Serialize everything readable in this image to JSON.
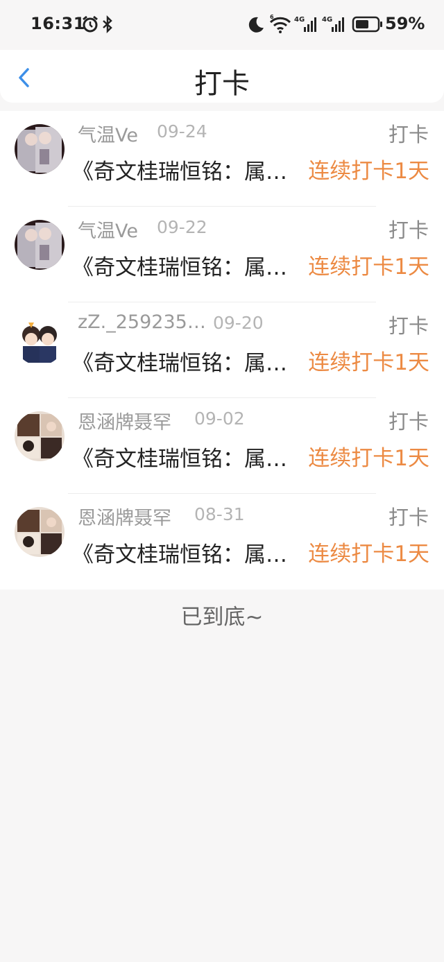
{
  "status_bar": {
    "time": "16:31",
    "battery": "59%",
    "icons": [
      "alarm-icon",
      "bluetooth-icon",
      "moon-icon",
      "wifi-icon",
      "signal-4g-icon",
      "signal-4g-icon",
      "battery-icon"
    ]
  },
  "header": {
    "title": "打卡",
    "back_icon": "chevron-left-icon"
  },
  "entries": [
    {
      "name": "气温Ve",
      "date": "09-24",
      "tag": "打卡",
      "content": "《奇文桂瑞恒铭：属…",
      "streak": "连续打卡1天",
      "avatar": "avatar-photo"
    },
    {
      "name": "气温Ve",
      "date": "09-22",
      "tag": "打卡",
      "content": "《奇文桂瑞恒铭：属…",
      "streak": "连续打卡1天",
      "avatar": "avatar-photo"
    },
    {
      "name": "zZ._259235…",
      "date": "09-20",
      "tag": "打卡",
      "content": "《奇文桂瑞恒铭：属…",
      "streak": "连续打卡1天",
      "avatar": "avatar-cartoon"
    },
    {
      "name": "恩涵牌聂罕",
      "date": "09-02",
      "tag": "打卡",
      "content": "《奇文桂瑞恒铭：属…",
      "streak": "连续打卡1天",
      "avatar": "avatar-collage"
    },
    {
      "name": "恩涵牌聂罕",
      "date": "08-31",
      "tag": "打卡",
      "content": "《奇文桂瑞恒铭：属…",
      "streak": "连续打卡1天",
      "avatar": "avatar-collage"
    }
  ],
  "footer": {
    "text": "已到底~"
  },
  "colors": {
    "accent": "#ec8a43",
    "back": "#3d8fe8",
    "background": "#f7f6f6"
  }
}
